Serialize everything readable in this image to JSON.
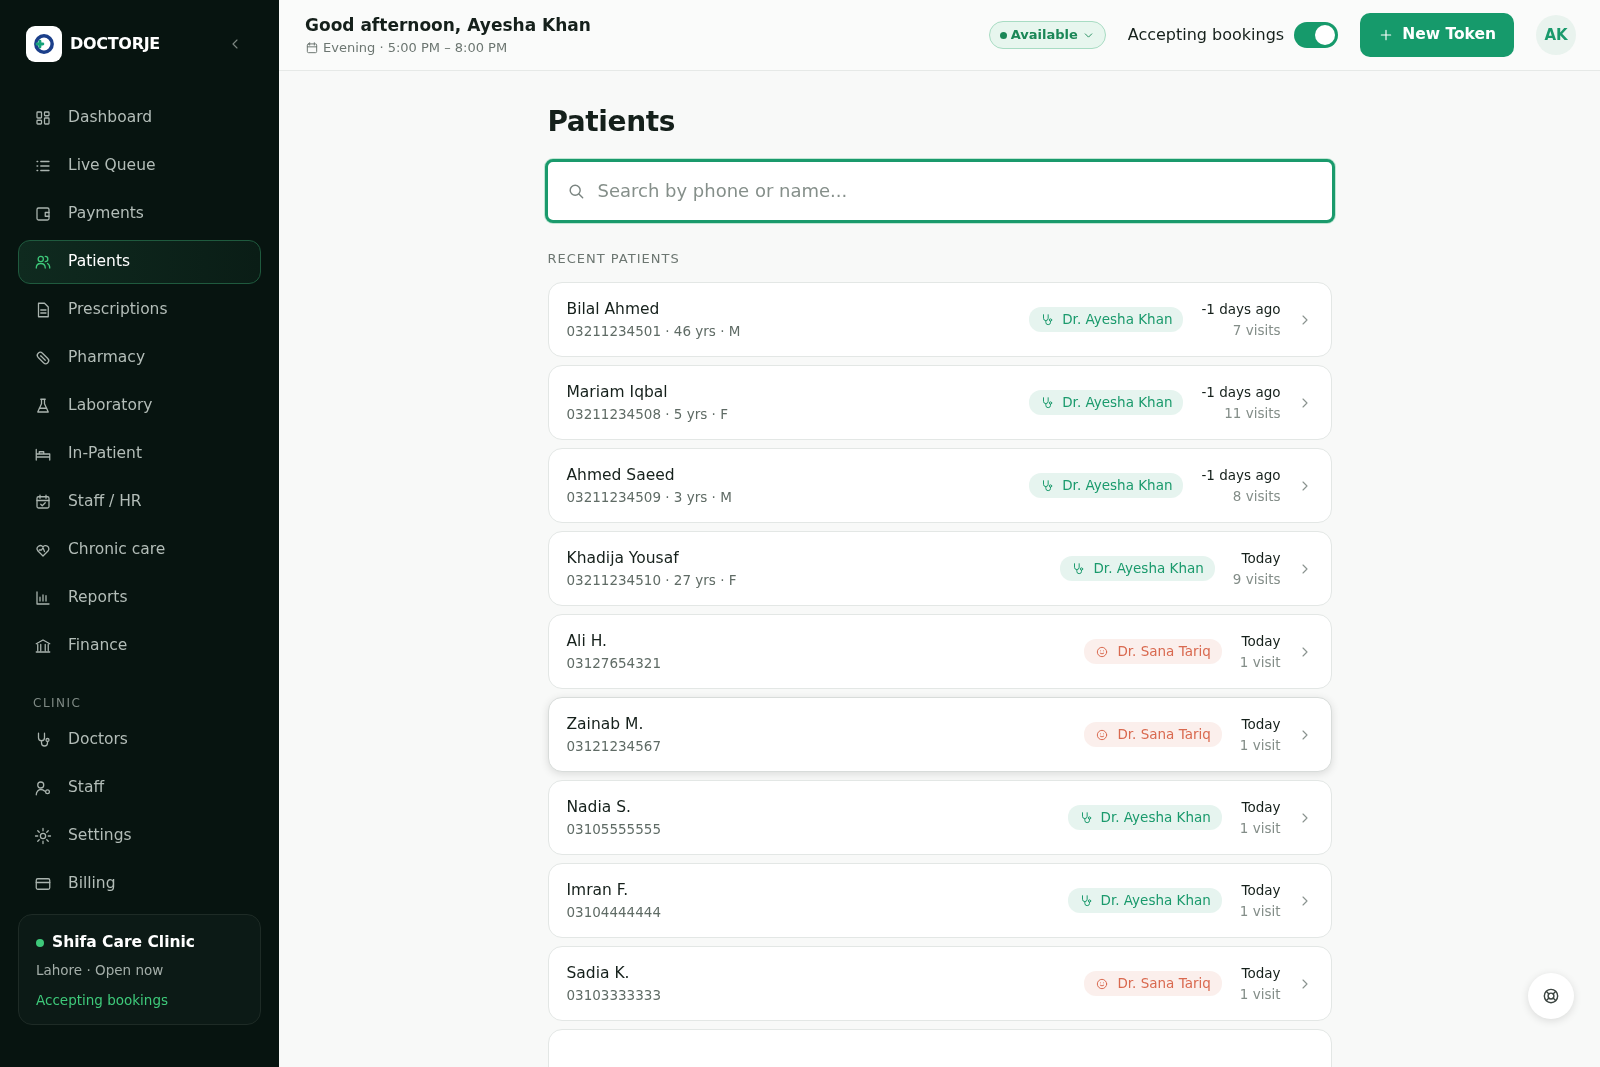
{
  "sidebar": {
    "brand": "DOCTORJE",
    "items": [
      {
        "label": "Dashboard",
        "selected": false
      },
      {
        "label": "Live Queue",
        "selected": false
      },
      {
        "label": "Payments",
        "selected": false
      },
      {
        "label": "Patients",
        "selected": true
      },
      {
        "label": "Prescriptions",
        "selected": false
      },
      {
        "label": "Pharmacy",
        "selected": false
      },
      {
        "label": "Laboratory",
        "selected": false
      },
      {
        "label": "In-Patient",
        "selected": false
      },
      {
        "label": "Staff / HR",
        "selected": false
      },
      {
        "label": "Chronic care",
        "selected": false
      },
      {
        "label": "Reports",
        "selected": false
      },
      {
        "label": "Finance",
        "selected": false
      }
    ],
    "section_title": "CLINIC",
    "clinic_items": [
      {
        "label": "Doctors",
        "selected": false
      },
      {
        "label": "Staff",
        "selected": false
      },
      {
        "label": "Settings",
        "selected": false
      },
      {
        "label": "Billing",
        "selected": false
      }
    ],
    "clinic_card": {
      "name": "Shifa Care Clinic",
      "color": "#3ec97a",
      "detail": "Lahore · Open now",
      "note": "Accepting bookings"
    }
  },
  "header": {
    "greeting": "Good afternoon, Ayesha Khan",
    "shift": "Evening · 5:00 PM – 8:00 PM",
    "availability": "Available",
    "toggle_label": "Accepting bookings",
    "accepting_on": true,
    "new_button": "New Token",
    "avatar": "AK"
  },
  "page": {
    "title": "Patients",
    "search": {
      "placeholder": "Search by phone or name..."
    },
    "section_label": "RECENT PATIENTS",
    "patients": [
      {
        "name": "Bilal Ahmed",
        "info": "03211234501 · 46 yrs · M",
        "doctor": "Dr. Ayesha Khan",
        "kind": "stethoscope",
        "color": "#1a9a6c",
        "when": "-1 days ago",
        "visits": "7 visits",
        "hovered": false
      },
      {
        "name": "Mariam Iqbal",
        "info": "03211234508 · 5 yrs · F",
        "doctor": "Dr. Ayesha Khan",
        "kind": "stethoscope",
        "color": "#1a9a6c",
        "when": "-1 days ago",
        "visits": "11 visits",
        "hovered": false
      },
      {
        "name": "Ahmed Saeed",
        "info": "03211234509 · 3 yrs · M",
        "doctor": "Dr. Ayesha Khan",
        "kind": "stethoscope",
        "color": "#1a9a6c",
        "when": "-1 days ago",
        "visits": "8 visits",
        "hovered": false
      },
      {
        "name": "Khadija Yousaf",
        "info": "03211234510 · 27 yrs · F",
        "doctor": "Dr. Ayesha Khan",
        "kind": "stethoscope",
        "color": "#1a9a6c",
        "when": "Today",
        "visits": "9 visits",
        "hovered": false
      },
      {
        "name": "Ali H.",
        "info": "03127654321",
        "doctor": "Dr. Sana Tariq",
        "kind": "smiley",
        "color": "#d9694f",
        "when": "Today",
        "visits": "1 visit",
        "hovered": false
      },
      {
        "name": "Zainab M.",
        "info": "03121234567",
        "doctor": "Dr. Sana Tariq",
        "kind": "smiley",
        "color": "#d9694f",
        "when": "Today",
        "visits": "1 visit",
        "hovered": true
      },
      {
        "name": "Nadia S.",
        "info": "03105555555",
        "doctor": "Dr. Ayesha Khan",
        "kind": "stethoscope",
        "color": "#1a9a6c",
        "when": "Today",
        "visits": "1 visit",
        "hovered": false
      },
      {
        "name": "Imran F.",
        "info": "03104444444",
        "doctor": "Dr. Ayesha Khan",
        "kind": "stethoscope",
        "color": "#1a9a6c",
        "when": "Today",
        "visits": "1 visit",
        "hovered": false
      },
      {
        "name": "Sadia K.",
        "info": "03103333333",
        "doctor": "Dr. Sana Tariq",
        "kind": "smiley",
        "color": "#d9694f",
        "when": "Today",
        "visits": "1 visit",
        "hovered": false
      }
    ]
  }
}
